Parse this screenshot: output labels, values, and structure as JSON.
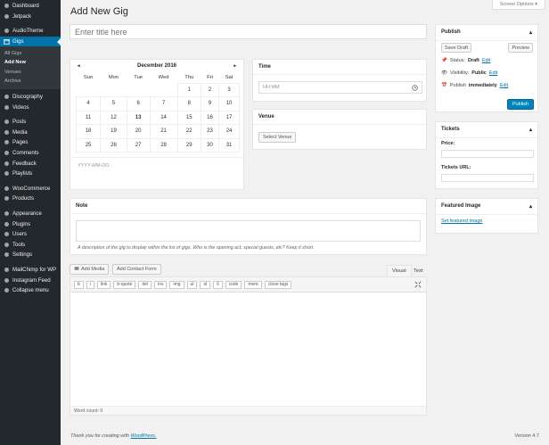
{
  "sidebar": {
    "items_top": [
      {
        "label": "Dashboard",
        "icon": "dashboard-icon"
      },
      {
        "label": "Jetpack",
        "icon": "jetpack-icon"
      }
    ],
    "items_theme": [
      {
        "label": "AudioTheme",
        "icon": "audiotheme-icon"
      }
    ],
    "gigs_label": "Gigs",
    "gigs_submenu": [
      "All Gigs",
      "Add New",
      "Venues",
      "Archive"
    ],
    "items_mid": [
      {
        "label": "Discography",
        "icon": "disc-icon"
      },
      {
        "label": "Videos",
        "icon": "video-icon"
      }
    ],
    "items_content": [
      {
        "label": "Posts",
        "icon": "pin-icon"
      },
      {
        "label": "Media",
        "icon": "media-icon"
      },
      {
        "label": "Pages",
        "icon": "page-icon"
      },
      {
        "label": "Comments",
        "icon": "comment-icon"
      },
      {
        "label": "Feedback",
        "icon": "feedback-icon"
      },
      {
        "label": "Playlists",
        "icon": "playlist-icon"
      }
    ],
    "items_shop": [
      {
        "label": "WooCommerce",
        "icon": "woo-icon"
      },
      {
        "label": "Products",
        "icon": "products-icon"
      }
    ],
    "items_admin": [
      {
        "label": "Appearance",
        "icon": "brush-icon"
      },
      {
        "label": "Plugins",
        "icon": "plugin-icon"
      },
      {
        "label": "Users",
        "icon": "user-icon"
      },
      {
        "label": "Tools",
        "icon": "wrench-icon"
      },
      {
        "label": "Settings",
        "icon": "settings-icon"
      }
    ],
    "items_extra": [
      {
        "label": "MailChimp for WP",
        "icon": "mailchimp-icon"
      },
      {
        "label": "Instagram Feed",
        "icon": "instagram-icon"
      },
      {
        "label": "Collapse menu",
        "icon": "collapse-icon"
      }
    ]
  },
  "header": {
    "title": "Add New Gig",
    "screen_options": "Screen Options ▾",
    "title_placeholder": "Enter title here"
  },
  "calendar": {
    "month": "December 2016",
    "prev": "◂",
    "next": "▸",
    "weekdays": [
      "Sun",
      "Mon",
      "Tue",
      "Wed",
      "Thu",
      "Fri",
      "Sat"
    ],
    "weeks": [
      [
        "",
        "",
        "",
        "",
        "1",
        "2",
        "3"
      ],
      [
        "4",
        "5",
        "6",
        "7",
        "8",
        "9",
        "10"
      ],
      [
        "11",
        "12",
        "13",
        "14",
        "15",
        "16",
        "17"
      ],
      [
        "18",
        "19",
        "20",
        "21",
        "22",
        "23",
        "24"
      ],
      [
        "25",
        "26",
        "27",
        "28",
        "29",
        "30",
        "31"
      ]
    ],
    "today": "13",
    "format_hint": "YYYY-MM-DD"
  },
  "time": {
    "heading": "Time",
    "placeholder": "HH:MM"
  },
  "venue": {
    "heading": "Venue",
    "button": "Select Venue"
  },
  "note": {
    "heading": "Note",
    "description": "A description of the gig to display within the list of gigs. Who is the opening act, special guests, etc? Keep it short."
  },
  "editor": {
    "add_media": "Add Media",
    "add_contact_form": "Add Contact Form",
    "tab_visual": "Visual",
    "tab_text": "Text",
    "quicktags": [
      "b",
      "i",
      "link",
      "b-quote",
      "del",
      "ins",
      "img",
      "ul",
      "ol",
      "li",
      "code",
      "more",
      "close tags"
    ],
    "word_count": "Word count: 0"
  },
  "publish": {
    "heading": "Publish",
    "save_draft": "Save Draft",
    "preview": "Preview",
    "status_label": "Status:",
    "status_value": "Draft",
    "visibility_label": "Visibility:",
    "visibility_value": "Public",
    "publish_label": "Publish",
    "publish_value": "immediately",
    "edit": "Edit",
    "publish_button": "Publish"
  },
  "tickets": {
    "heading": "Tickets",
    "price_label": "Price:",
    "url_label": "Tickets URL:"
  },
  "featured": {
    "heading": "Featured Image",
    "link": "Set featured image"
  },
  "footer": {
    "thanks": "Thank you for creating with ",
    "wp_link": "WordPress.",
    "version": "Version 4.7"
  },
  "colors": {
    "sidebar_bg": "#23282d",
    "accent": "#0073aa",
    "page_bg": "#f1f1f1"
  }
}
